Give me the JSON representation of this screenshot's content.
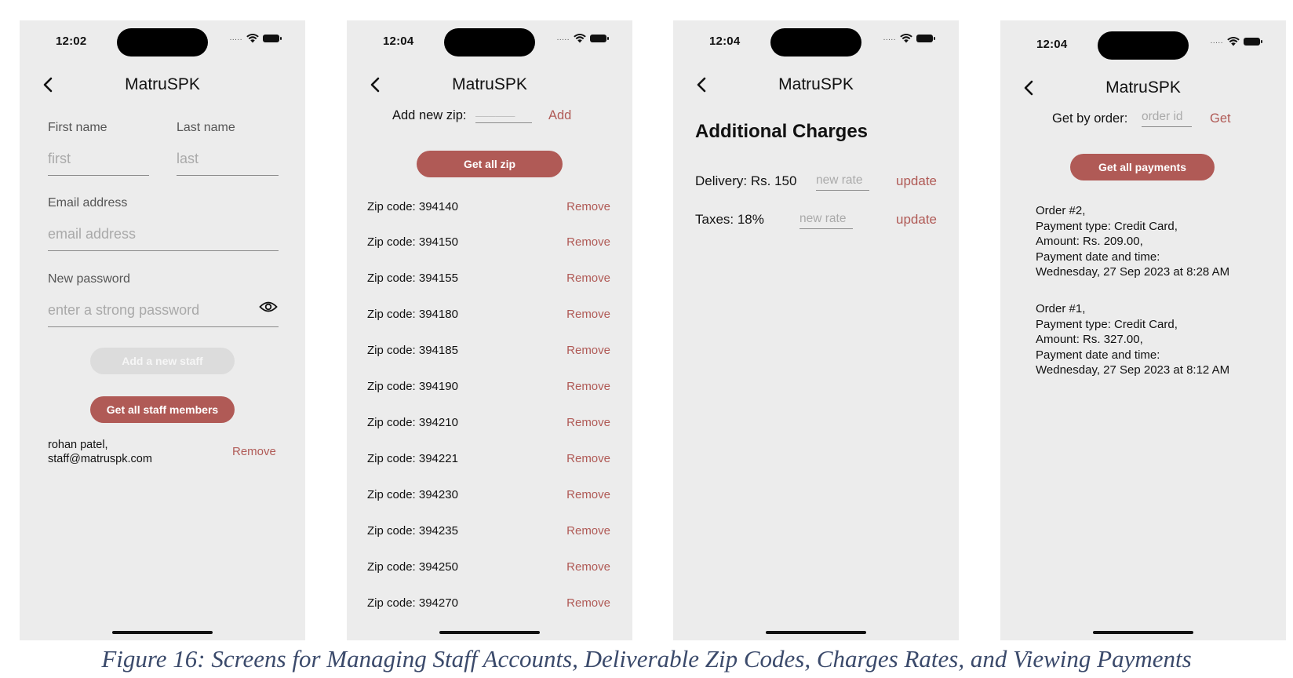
{
  "status": {
    "wifi_icon": "wifi-icon",
    "battery_icon": "battery-icon",
    "signal": "....."
  },
  "staff_screen": {
    "time": "12:02",
    "title": "MatruSPK",
    "first_name_label": "First name",
    "first_name_placeholder": "first",
    "last_name_label": "Last name",
    "last_name_placeholder": "last",
    "email_label": "Email address",
    "email_placeholder": "email address",
    "password_label": "New password",
    "password_placeholder": "enter a strong password",
    "add_button": "Add a new staff",
    "get_all_button": "Get all staff members",
    "staff": [
      {
        "name": "rohan patel,",
        "email": "staff@matruspk.com",
        "action": "Remove"
      }
    ]
  },
  "zip_screen": {
    "time": "12:04",
    "title": "MatruSPK",
    "add_label": "Add new zip:",
    "zip_placeholder": "______",
    "add_button": "Add",
    "get_all_button": "Get all zip",
    "remove_label": "Remove",
    "zips": [
      "Zip code: 394140",
      "Zip code: 394150",
      "Zip code: 394155",
      "Zip code: 394180",
      "Zip code: 394185",
      "Zip code: 394190",
      "Zip code: 394210",
      "Zip code: 394221",
      "Zip code: 394230",
      "Zip code: 394235",
      "Zip code: 394250",
      "Zip code: 394270"
    ]
  },
  "charges_screen": {
    "time": "12:04",
    "title": "MatruSPK",
    "heading": "Additional Charges",
    "rows": [
      {
        "label": "Delivery: Rs. 150",
        "placeholder": "new rate",
        "action": "update"
      },
      {
        "label": "Taxes: 18%",
        "placeholder": "new rate",
        "action": "update"
      }
    ]
  },
  "payments_screen": {
    "time": "12:04",
    "title": "MatruSPK",
    "get_label": "Get by order:",
    "order_placeholder": "order id",
    "get_button": "Get",
    "get_all_button": "Get all payments",
    "payments": [
      {
        "order": "Order #2,",
        "type": "Payment type: Credit Card,",
        "amount": "Amount: Rs. 209.00,",
        "date_label": "Payment date and time:",
        "date": "Wednesday, 27 Sep 2023 at 8:28 AM"
      },
      {
        "order": "Order #1,",
        "type": "Payment type: Credit Card,",
        "amount": "Amount: Rs. 327.00,",
        "date_label": "Payment date and time:",
        "date": "Wednesday, 27 Sep 2023 at 8:12 AM"
      }
    ]
  },
  "caption": "Figure 16: Screens for Managing Staff Accounts, Deliverable Zip Codes, Charges Rates, and Viewing Payments",
  "colors": {
    "accent": "#b05a56",
    "screen_bg": "#ececec",
    "caption": "#3b4a6b",
    "disabled_button": "#dcdcdc"
  }
}
